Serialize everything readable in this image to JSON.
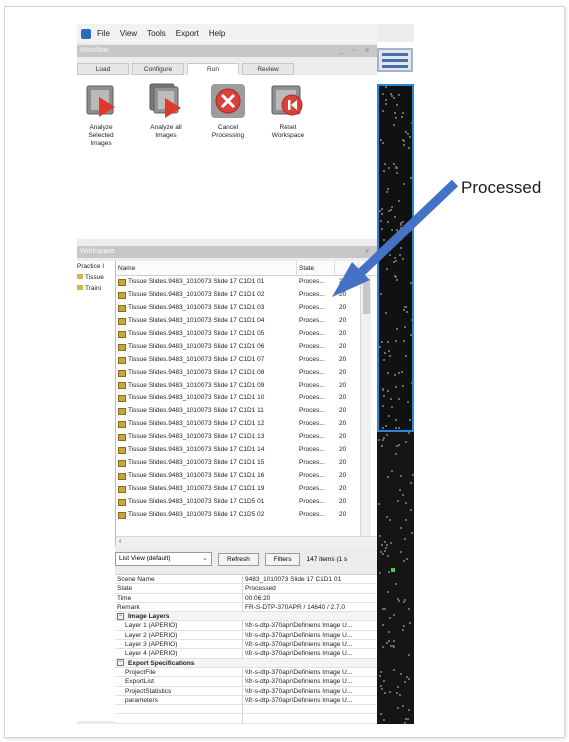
{
  "menu": [
    "File",
    "View",
    "Tools",
    "Export",
    "Help"
  ],
  "workflow": {
    "title": "Workflow",
    "window_controls": "_ ▫ x",
    "tabs": [
      "Load",
      "Configure",
      "Run",
      "Review"
    ],
    "active_tab": "Run",
    "buttons": [
      {
        "label": "Analyze Selected Images",
        "icon": "analyze-selected-icon"
      },
      {
        "label": "Analyze all Images",
        "icon": "analyze-all-icon"
      },
      {
        "label": "Cancel Processing",
        "icon": "cancel-icon"
      },
      {
        "label": "Reset Workspace",
        "icon": "reset-icon"
      }
    ]
  },
  "workspace": {
    "title": "Workspace",
    "close": "x",
    "tree": [
      "Practice I",
      "Tissue",
      "Traini"
    ],
    "columns": [
      "Name",
      "State"
    ],
    "rows": [
      {
        "name": "Tissue Slides.9483_1010073 Slide 17 C1D1 01",
        "state": "Proces...",
        "date": "20"
      },
      {
        "name": "Tissue Slides.9483_1010073 Slide 17 C1D1 02",
        "state": "Proces...",
        "date": "20"
      },
      {
        "name": "Tissue Slides.9483_1010073 Slide 17 C1D1 03",
        "state": "Proces...",
        "date": "20"
      },
      {
        "name": "Tissue Slides.9483_1010073 Slide 17 C1D1 04",
        "state": "Proces...",
        "date": "20"
      },
      {
        "name": "Tissue Slides.9483_1010073 Slide 17 C1D1 05",
        "state": "Proces...",
        "date": "20"
      },
      {
        "name": "Tissue Slides.9483_1010073 Slide 17 C1D1 06",
        "state": "Proces...",
        "date": "20"
      },
      {
        "name": "Tissue Slides.9483_1010073 Slide 17 C1D1 07",
        "state": "Proces...",
        "date": "20"
      },
      {
        "name": "Tissue Slides.9483_1010073 Slide 17 C1D1 08",
        "state": "Proces...",
        "date": "20"
      },
      {
        "name": "Tissue Slides.9483_1010073 Slide 17 C1D1 09",
        "state": "Proces...",
        "date": "20"
      },
      {
        "name": "Tissue Slides.9483_1010073 Slide 17 C1D1 10",
        "state": "Proces...",
        "date": "20"
      },
      {
        "name": "Tissue Slides.9483_1010073 Slide 17 C1D1 11",
        "state": "Proces...",
        "date": "20"
      },
      {
        "name": "Tissue Slides.9483_1010073 Slide 17 C1D1 12",
        "state": "Proces...",
        "date": "20"
      },
      {
        "name": "Tissue Slides.9483_1010073 Slide 17 C1D1 13",
        "state": "Proces...",
        "date": "20"
      },
      {
        "name": "Tissue Slides.9483_1010073 Slide 17 C1D1 14",
        "state": "Proces...",
        "date": "20"
      },
      {
        "name": "Tissue Slides.9483_1010073 Slide 17 C1D1 15",
        "state": "Proces...",
        "date": "20"
      },
      {
        "name": "Tissue Slides.9483_1010073 Slide 17 C1D1 16",
        "state": "Proces...",
        "date": "20"
      },
      {
        "name": "Tissue Slides.9483_1010073 Slide 17 C1D1 19",
        "state": "Proces...",
        "date": "20"
      },
      {
        "name": "Tissue Slides.9483_1010073 Slide 17 C1D5 01",
        "state": "Proces...",
        "date": "20"
      },
      {
        "name": "Tissue Slides.9483_1010073 Slide 17 C1D5 02",
        "state": "Proces...",
        "date": "20"
      }
    ],
    "view_select": "List View (default)",
    "refresh_label": "Refresh",
    "filters_label": "Filters",
    "item_count": "147 items (1 s"
  },
  "properties": {
    "general": [
      {
        "key": "Scene Name",
        "value": "9483_1010073 Slide 17 C1D1 01"
      },
      {
        "key": "State",
        "value": "Processed"
      },
      {
        "key": "Time",
        "value": "00:06:20"
      },
      {
        "key": "Remark",
        "value": "FR-S-DTP-370APR / 14640 / 2.7.0"
      }
    ],
    "image_layers_title": "Image Layers",
    "image_layers": [
      {
        "key": "Layer 1 (APERIO)",
        "value": "\\\\fr-s-dtp-370apr\\Definiens Image U..."
      },
      {
        "key": "Layer 2 (APERIO)",
        "value": "\\\\fr-s-dtp-370apr\\Definiens Image U..."
      },
      {
        "key": "Layer 3 (APERIO)",
        "value": "\\\\fr-s-dtp-370apr\\Definiens Image U..."
      },
      {
        "key": "Layer 4 (APERIO)",
        "value": "\\\\fr-s-dtp-370apr\\Definiens Image U..."
      }
    ],
    "export_title": "Export Specifications",
    "export": [
      {
        "key": "ProjectFile",
        "value": "\\\\fr-s-dtp-370apr\\Definiens Image U..."
      },
      {
        "key": "ExportList",
        "value": "\\\\fr-s-dtp-370apr\\Definiens Image U..."
      },
      {
        "key": "ProjectStatistics",
        "value": "\\\\fr-s-dtp-370apr\\Definiens Image U..."
      },
      {
        "key": "parameters",
        "value": "\\\\fr-s-dtp-370apr\\Definiens Image U..."
      }
    ]
  },
  "annotation": {
    "label": "Processed",
    "arrow_color": "#4472c4"
  },
  "colors": {
    "accent": "#2a86d6",
    "play_red": "#e0392b",
    "cancel_red": "#d9413a"
  }
}
